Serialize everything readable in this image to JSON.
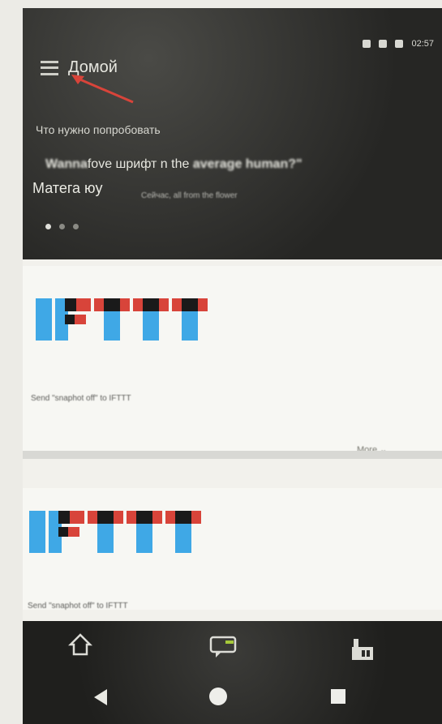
{
  "status": {
    "time": "02:57"
  },
  "header": {
    "title": "Домой",
    "subtitle": "Что нужно попробовать",
    "headline_blur_1": "Wanna",
    "headline_clear": "fove шрифт n the ",
    "headline_blur_2": "average human?\"",
    "line2": "Матега юу",
    "caption": "Сейчас, all from the flower"
  },
  "cards": [
    {
      "text": "Send \"snaphot off\" to IFTTT"
    },
    {
      "text": "Send \"snaphot off\" to IFTTT"
    }
  ],
  "more_label": "More",
  "nav": {
    "home": "home-icon",
    "chat": "chat-icon",
    "profile": "profile-icon"
  },
  "colors": {
    "ifttt_blue": "#3fa8e6",
    "ifttt_red": "#d8443a",
    "accent_arrow": "#d8443a"
  }
}
